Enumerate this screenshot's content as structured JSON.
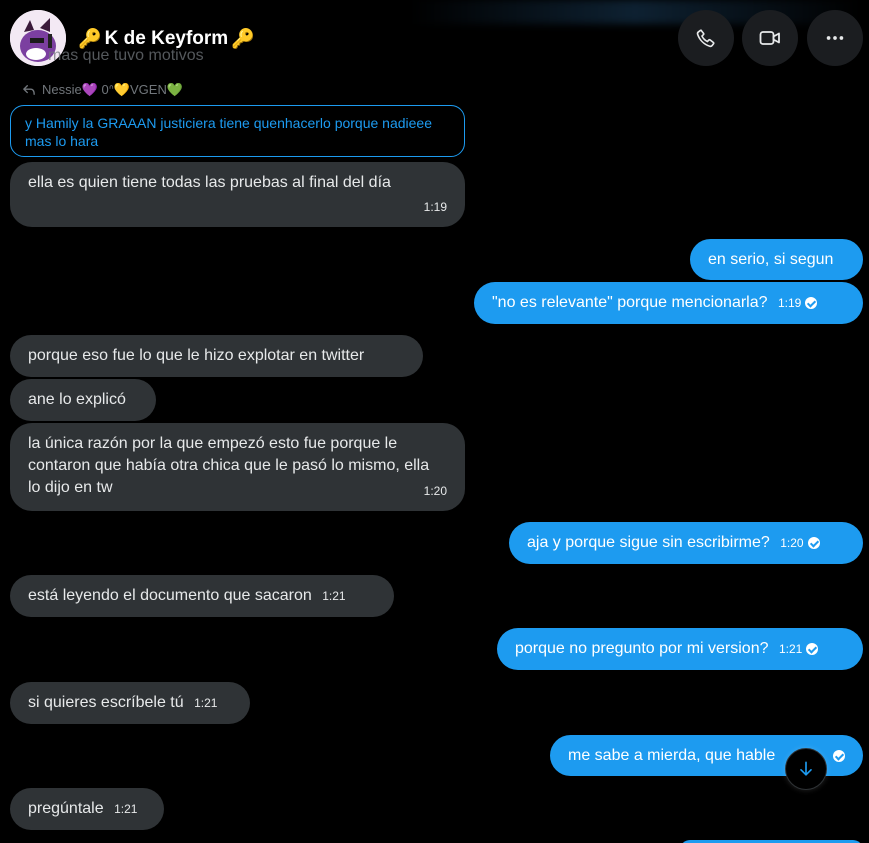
{
  "header": {
    "contact_name": "K de Keyform",
    "title_prefix": "🔑",
    "title_suffix": "🔑",
    "call_icon": "phone-icon",
    "video_icon": "video-icon",
    "more_icon": "more-icon"
  },
  "partial_message": "mas que tuvo motivos",
  "reply": {
    "author": "Nessie💜 0ᐢ💛VGEN💚",
    "quoted_text": "y Hamily la GRAAAN justiciera tiene quenhacerlo porque nadieee mas lo hara"
  },
  "messages": [
    {
      "dir": "in",
      "text": "ella es quien tiene todas las pruebas al final del día",
      "time": "1:19"
    },
    {
      "dir": "out",
      "text": "en serio, si segun",
      "time": ""
    },
    {
      "dir": "out",
      "text": "\"no es relevante\" porque mencionarla?",
      "time": "1:19"
    },
    {
      "dir": "in",
      "text": "porque eso fue lo que le hizo explotar en twitter",
      "time": ""
    },
    {
      "dir": "in",
      "text": "ane lo explicó",
      "time": ""
    },
    {
      "dir": "in",
      "text": "la única razón por la que empezó esto fue porque le contaron que había otra chica que le pasó lo mismo, ella lo dijo en tw",
      "time": "1:20"
    },
    {
      "dir": "out",
      "text": "aja y porque sigue sin escribirme?",
      "time": "1:20"
    },
    {
      "dir": "in",
      "text": "está leyendo el documento que sacaron",
      "time": "1:21"
    },
    {
      "dir": "out",
      "text": "porque no pregunto por mi version?",
      "time": "1:21"
    },
    {
      "dir": "in",
      "text": "si quieres escríbele tú",
      "time": "1:21"
    },
    {
      "dir": "out",
      "text": "me sabe a mierda, que hable",
      "time": ""
    },
    {
      "dir": "in",
      "text": "pregúntale",
      "time": "1:21"
    }
  ],
  "colors": {
    "background": "#000000",
    "incoming_bubble": "#2f3336",
    "outgoing_bubble": "#1d9bf0",
    "accent": "#1d9bf0",
    "muted_text": "#71767b"
  },
  "scroll_down_icon": "arrow-down-icon"
}
